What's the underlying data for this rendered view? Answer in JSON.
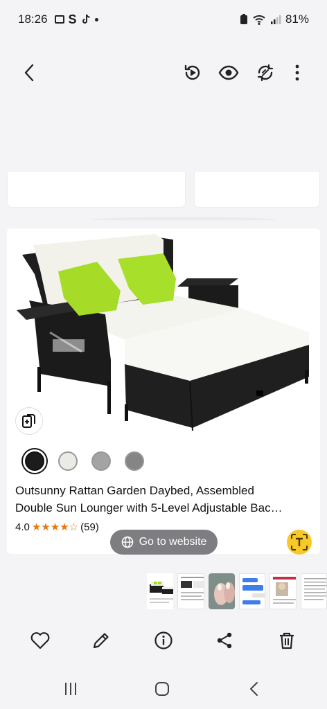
{
  "status_bar": {
    "time": "18:26",
    "app_letter": "S",
    "battery": "81%"
  },
  "product": {
    "title_line1": "Outsunny Rattan Garden Daybed, Assembled",
    "title_line2": "Double Sun Lounger with 5-Level Adjustable Bac…",
    "rating": "4.0",
    "stars_filled": 4,
    "stars_total": 5,
    "review_count": "(59)",
    "swatches": [
      {
        "name": "black",
        "color": "#1c1c1c",
        "selected": true
      },
      {
        "name": "cream",
        "color": "#ebebe6",
        "selected": false
      },
      {
        "name": "grey",
        "color": "#a3a3a3",
        "selected": false
      },
      {
        "name": "dark-grey",
        "color": "#858585",
        "selected": false
      }
    ]
  },
  "overlay": {
    "go_to_website": "Go to website"
  },
  "colors": {
    "accent_orange": "#e47911",
    "lens_yellow": "#f7c82a",
    "pill_grey": "#7d7d82",
    "cushion_green": "#a6dc28"
  },
  "icons": {
    "top": [
      "back-icon",
      "motion-photo-icon",
      "eye-icon",
      "remaster-icon",
      "more-vert-icon"
    ],
    "actions": [
      "heart-icon",
      "edit-icon",
      "info-icon",
      "share-icon",
      "trash-icon"
    ],
    "nav": [
      "recents-icon",
      "home-icon",
      "back-nav-icon"
    ]
  }
}
